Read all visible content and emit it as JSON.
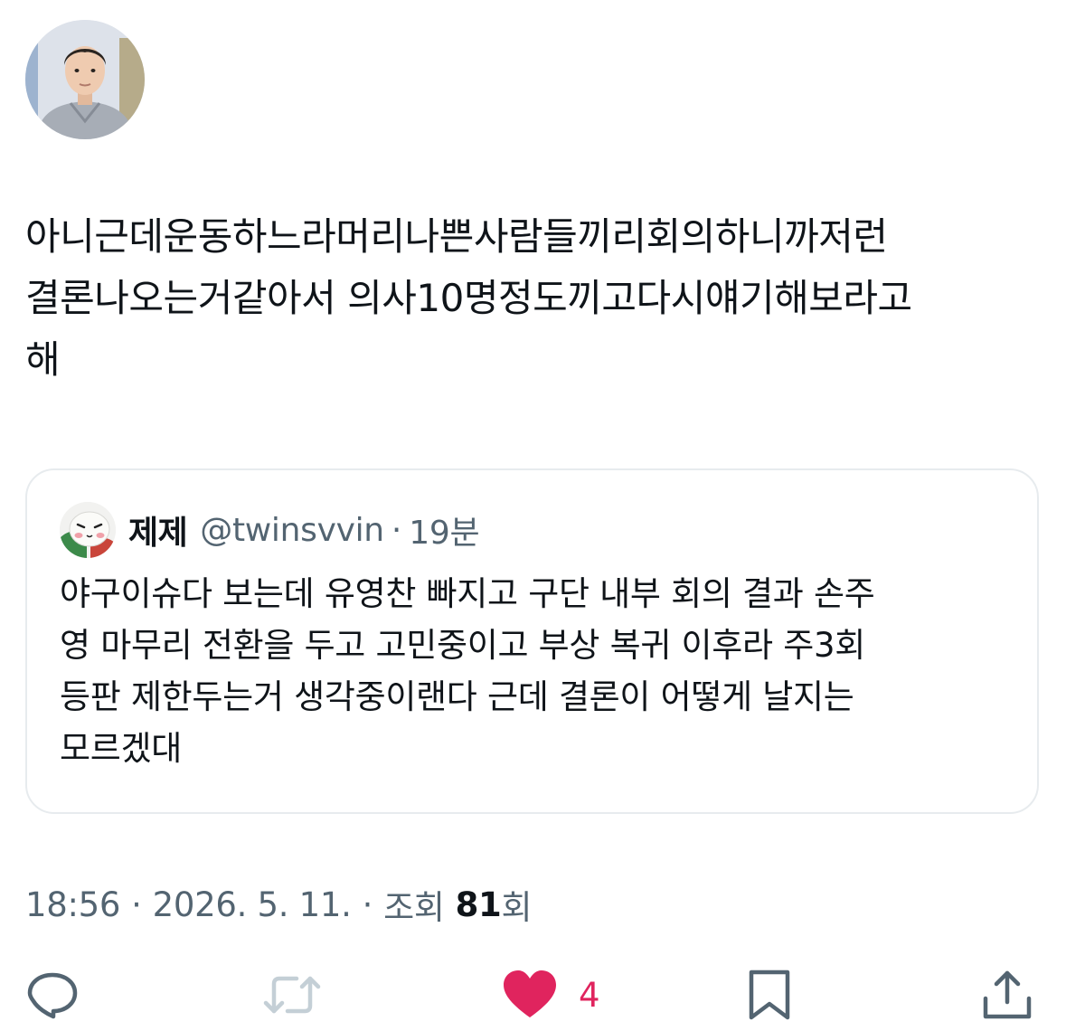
{
  "tweet": {
    "author_avatar_icon": "profile-photo",
    "text": "아니근데운동하느라머리나쁜사람들끼리회의하니까저런\n결론나오는거같아서 의사10명정도끼고다시얘기해보라고\n해",
    "timestamp": "18:56",
    "date": "2026. 5. 11.",
    "views_label": "조회",
    "views_count": "81",
    "views_suffix": "회",
    "separator": "·"
  },
  "quote": {
    "avatar_icon": "character-avatar",
    "name": "제제",
    "handle": "@twinsvvin",
    "separator": "·",
    "time": "19분",
    "text": "야구이슈다 보는데 유영찬 빠지고 구단 내부 회의 결과 손주\n영 마무리 전환을 두고 고민중이고 부상 복귀 이후라 주3회\n등판 제한두는거 생각중이랜다 근데 결론이 어떻게 날지는\n모르겠대"
  },
  "actions": {
    "reply_icon": "reply-icon",
    "retweet_icon": "retweet-icon",
    "like_icon": "heart-filled-icon",
    "like_count": "4",
    "bookmark_icon": "bookmark-icon",
    "share_icon": "share-icon"
  },
  "colors": {
    "text": "#0f1419",
    "secondary": "#536471",
    "like": "#e0245e",
    "border": "#e7ebee",
    "retweet_disabled": "#c4cfd6"
  }
}
